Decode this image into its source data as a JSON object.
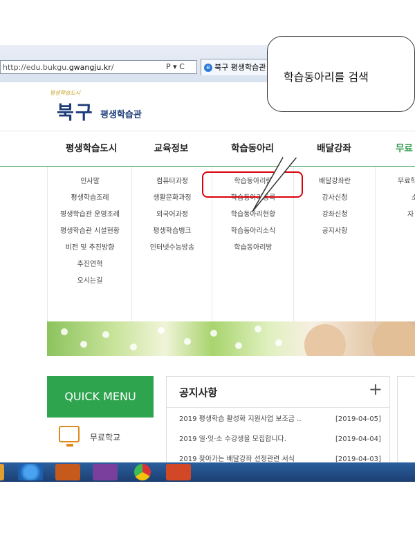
{
  "browser": {
    "address_prefix": "http://edu.bukgu.",
    "address_domain": "gwangju.kr",
    "address_suffix": "/",
    "address_tools": "P ▾ C",
    "tab_title": "북구 평생학습관"
  },
  "site": {
    "logo_small": "평생학습도시",
    "logo_main": "북구",
    "logo_sub": "평생학습관"
  },
  "gnb": [
    "평생학습도시",
    "교육정보",
    "학습동아리",
    "배달강좌",
    "무료"
  ],
  "dropdown": {
    "col1": [
      "인사말",
      "평생학습조례",
      "평생학습관 운영조례",
      "평생학습관 시설현황",
      "비전 및 추진방향",
      "추진연혁",
      "오시는길"
    ],
    "col2": [
      "컴퓨터과정",
      "생활문화과정",
      "외국어과정",
      "평생학습뱅크",
      "인터넷수능방송"
    ],
    "col3": [
      "학습동아리란",
      "학습동아리등록",
      "학습동아리현황",
      "학습동아리소식",
      "학습동아리방"
    ],
    "col4": [
      "배달강좌란",
      "강사신청",
      "강좌신청",
      "공지사항"
    ],
    "col5": [
      "무료학",
      "소",
      "자"
    ]
  },
  "quick": {
    "title": "QUICK MENU",
    "item": "무료학교"
  },
  "notice": {
    "title": "공지사항",
    "plus": "+",
    "rows": [
      {
        "title": "2019 평생학습 활성화 지원사업 보조금 ..",
        "date": "[2019-04-05]"
      },
      {
        "title": "2019 일·잇·소 수강생을 모집합니다.",
        "date": "[2019-04-04]"
      },
      {
        "title": "2019 찾아가는 배달강좌 선정관련 서식",
        "date": "[2019-04-03]"
      }
    ]
  },
  "callout": {
    "text": "학습동아리를 검색"
  },
  "colors": {
    "accent_green": "#2ea44f",
    "highlight_red": "#d8000a",
    "logo_navy": "#1d3c7a"
  }
}
